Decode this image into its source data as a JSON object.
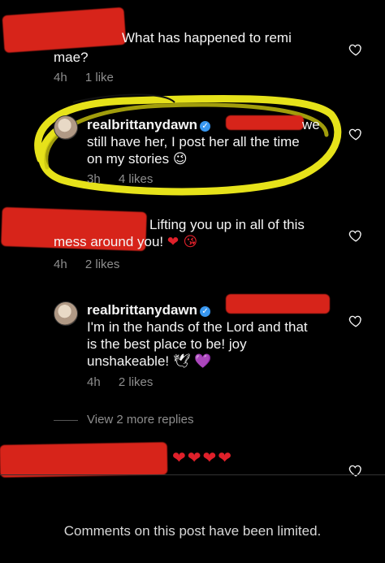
{
  "comments": [
    {
      "text_line1": "What has happened to remi",
      "text_line2": "mae?",
      "time": "4h",
      "likes": "1 like"
    },
    {
      "username": "realbrittanydawn",
      "text_tail": "we",
      "text_line2": "still have her, I post her all the time",
      "text_line3": "on my stories",
      "emoji": "😉",
      "time": "3h",
      "likes": "4 likes"
    },
    {
      "text_line1": "Lifting you up in all of this",
      "text_line2": "mess around you!",
      "emoji": "❤ 😘",
      "time": "4h",
      "likes": "2 likes"
    },
    {
      "username": "realbrittanydawn",
      "text_line1": "I'm in the hands of the Lord and that",
      "text_line2": "is the best place to be! joy",
      "text_line3": "unshakeable!",
      "emoji_dove": "🕊",
      "emoji_heart": "💜",
      "time": "4h",
      "likes": "2 likes"
    }
  ],
  "view_more": "View 2 more replies",
  "last_comment": {
    "hearts": "❤❤❤❤"
  },
  "footer": "Comments on this post have been limited.",
  "icons": {
    "like": "heart-outline-icon",
    "verified": "verified-badge-icon"
  },
  "colors": {
    "background": "#000000",
    "text": "#f5f5f5",
    "meta": "#8e8e8e",
    "verified": "#3897f0",
    "highlight": "#e6e21a",
    "redaction": "#e3261c"
  }
}
